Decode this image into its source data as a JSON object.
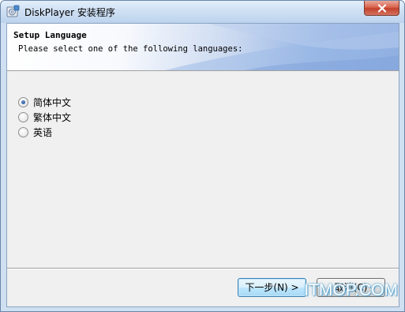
{
  "window": {
    "title": "DiskPlayer 安装程序",
    "app_icon": "installer-disk-icon",
    "close_icon": "close-icon"
  },
  "header": {
    "title": "Setup Language",
    "subtitle": "Please select one of the following languages:"
  },
  "languages": {
    "selected": "简体中文",
    "options": [
      {
        "label": "简体中文",
        "checked": true
      },
      {
        "label": "繁体中文",
        "checked": false
      },
      {
        "label": "英语",
        "checked": false
      }
    ]
  },
  "buttons": {
    "next_label": "下一步(N) >",
    "cancel_label": "取消(C)"
  },
  "watermark": {
    "text": "ITMOP.COM"
  },
  "colors": {
    "title_bar": "#cfe0f3",
    "close_button": "#d9644f",
    "header_gradient_end": "#7ea2dc",
    "dialog_background": "#f0f0f0",
    "radio_selected": "#2b5ea8"
  }
}
